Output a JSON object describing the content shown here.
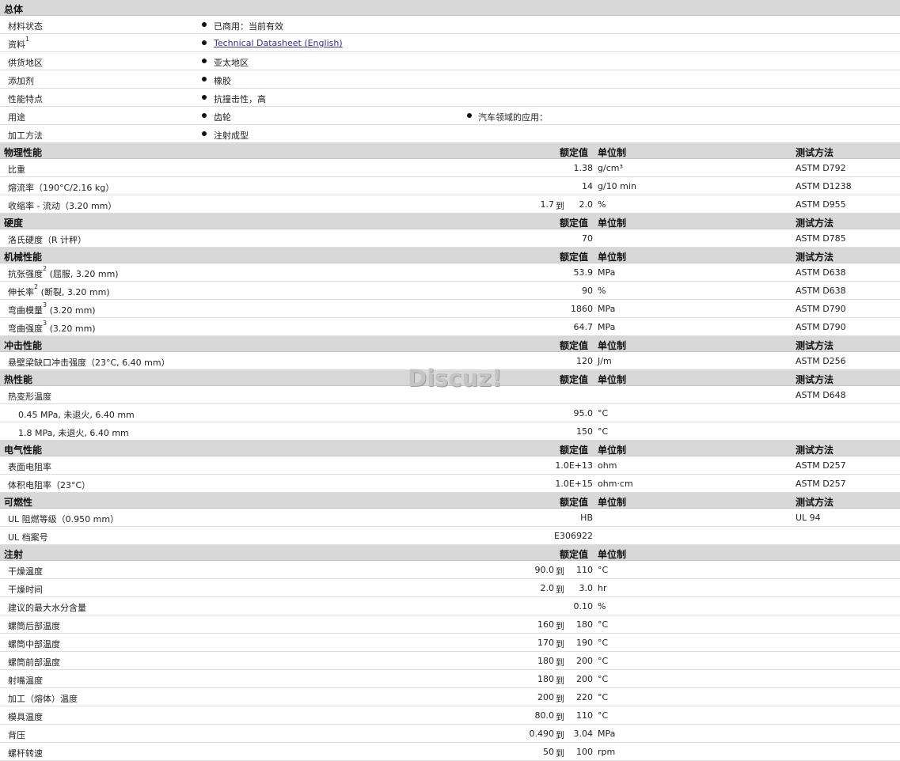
{
  "general": {
    "title": "总体",
    "rows": [
      {
        "label": "材料状态",
        "value": "已商用：当前有效"
      },
      {
        "label": "资料",
        "sup": "1",
        "value": "Technical Datasheet (English)",
        "link": true
      },
      {
        "label": "供货地区",
        "value": "亚太地区"
      },
      {
        "label": "添加剂",
        "value": "橡胶"
      },
      {
        "label": "性能特点",
        "value": "抗撞击性，高"
      },
      {
        "label": "用途",
        "value": "齿轮",
        "value2": "汽车领域的应用："
      },
      {
        "label": "加工方法",
        "value": "注射成型"
      }
    ]
  },
  "headers": {
    "nominal": "额定值",
    "unit": "单位制",
    "method": "测试方法"
  },
  "sections": [
    {
      "title": "物理性能",
      "method_header": true,
      "rows": [
        {
          "label": "比重",
          "value": "1.38",
          "unit": "g/cm³",
          "method": "ASTM D792"
        },
        {
          "label": "熔流率（190°C/2.16 kg）",
          "value": "14",
          "unit": "g/10 min",
          "method": "ASTM D1238"
        },
        {
          "label": "收缩率 - 流动（3.20 mm）",
          "from": "1.7",
          "to_word": "到",
          "to": "2.0",
          "unit": "%",
          "method": "ASTM D955"
        }
      ]
    },
    {
      "title": "硬度",
      "method_header": true,
      "rows": [
        {
          "label": "洛氏硬度（R 计秤）",
          "value": "70",
          "unit": "",
          "method": "ASTM D785"
        }
      ]
    },
    {
      "title": "机械性能",
      "method_header": true,
      "rows": [
        {
          "label": "抗张强度",
          "sup": "2",
          "suffix": "(屈服, 3.20 mm)",
          "value": "53.9",
          "unit": "MPa",
          "method": "ASTM D638"
        },
        {
          "label": "伸长率",
          "sup": "2",
          "suffix": "(断裂, 3.20 mm)",
          "value": "90",
          "unit": "%",
          "method": "ASTM D638"
        },
        {
          "label": "弯曲模量",
          "sup": "3",
          "suffix": "(3.20 mm)",
          "value": "1860",
          "unit": "MPa",
          "method": "ASTM D790"
        },
        {
          "label": "弯曲强度",
          "sup": "3",
          "suffix": "(3.20 mm)",
          "value": "64.7",
          "unit": "MPa",
          "method": "ASTM D790"
        }
      ]
    },
    {
      "title": "冲击性能",
      "method_header": true,
      "rows": [
        {
          "label": "悬壁梁缺口冲击强度（23°C, 6.40 mm）",
          "value": "120",
          "unit": "J/m",
          "method": "ASTM D256"
        }
      ]
    },
    {
      "title": "热性能",
      "method_header": true,
      "rows": [
        {
          "label": "热变形温度",
          "value": "",
          "unit": "",
          "method": "ASTM D648"
        },
        {
          "label": "0.45 MPa, 未退火, 6.40 mm",
          "indent": true,
          "value": "95.0",
          "unit": "°C",
          "method": ""
        },
        {
          "label": "1.8 MPa, 未退火, 6.40 mm",
          "indent": true,
          "value": "150",
          "unit": "°C",
          "method": ""
        }
      ]
    },
    {
      "title": "电气性能",
      "method_header": true,
      "rows": [
        {
          "label": "表面电阻率",
          "value": "1.0E+13",
          "unit": "ohm",
          "method": "ASTM D257"
        },
        {
          "label": "体积电阻率（23°C）",
          "value": "1.0E+15",
          "unit": "ohm·cm",
          "method": "ASTM D257"
        }
      ]
    },
    {
      "title": "可燃性",
      "method_header": true,
      "rows": [
        {
          "label": "UL 阻燃等级（0.950 mm）",
          "value": "HB",
          "unit": "",
          "method": "UL 94"
        },
        {
          "label": "UL 档案号",
          "value": "E306922",
          "unit": "",
          "method": ""
        }
      ]
    },
    {
      "title": "注射",
      "method_header": false,
      "rows": [
        {
          "label": "干燥温度",
          "from": "90.0",
          "to_word": "到",
          "to": "110",
          "unit": "°C"
        },
        {
          "label": "干燥时间",
          "from": "2.0",
          "to_word": "到",
          "to": "3.0",
          "unit": "hr"
        },
        {
          "label": "建议的最大水分含量",
          "value": "0.10",
          "unit": "%"
        },
        {
          "label": "螺筒后部温度",
          "from": "160",
          "to_word": "到",
          "to": "180",
          "unit": "°C"
        },
        {
          "label": "螺筒中部温度",
          "from": "170",
          "to_word": "到",
          "to": "190",
          "unit": "°C"
        },
        {
          "label": "螺筒前部温度",
          "from": "180",
          "to_word": "到",
          "to": "200",
          "unit": "°C"
        },
        {
          "label": "射嘴温度",
          "from": "180",
          "to_word": "到",
          "to": "200",
          "unit": "°C"
        },
        {
          "label": "加工（熔体）温度",
          "from": "200",
          "to_word": "到",
          "to": "220",
          "unit": "°C"
        },
        {
          "label": "模具温度",
          "from": "80.0",
          "to_word": "到",
          "to": "110",
          "unit": "°C"
        },
        {
          "label": "背压",
          "from": "0.490",
          "to_word": "到",
          "to": "3.04",
          "unit": "MPa"
        },
        {
          "label": "螺杆转速",
          "from": "50",
          "to_word": "到",
          "to": "100",
          "unit": "rpm"
        }
      ]
    }
  ],
  "watermark": "Discuz!"
}
